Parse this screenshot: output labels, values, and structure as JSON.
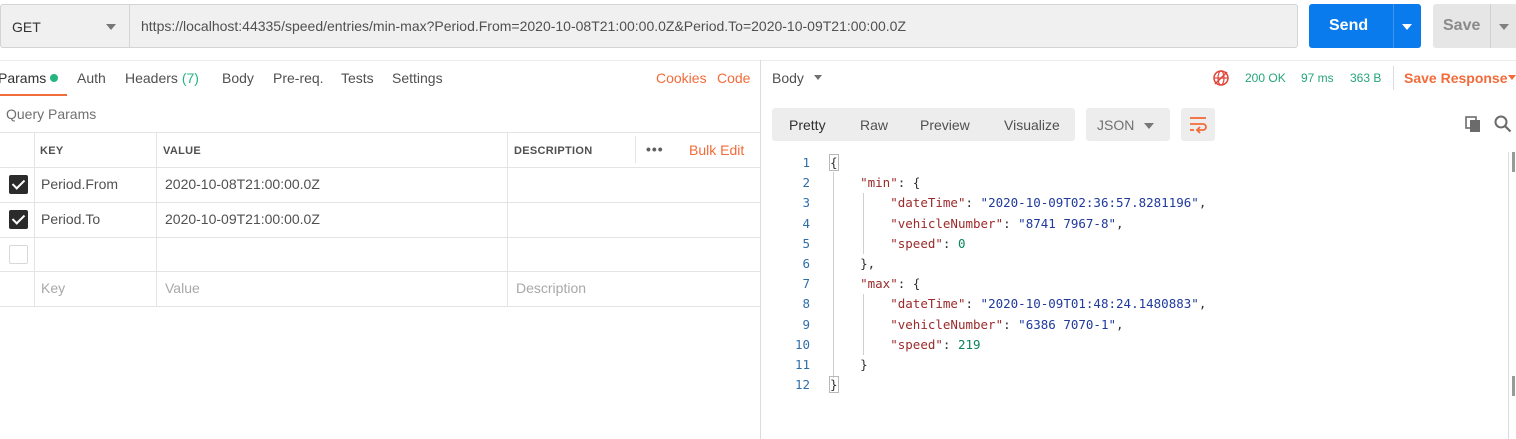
{
  "request": {
    "method": "GET",
    "url": "https://localhost:44335/speed/entries/min-max?Period.From=2020-10-08T21:00:00.0Z&Period.To=2020-10-09T21:00:00.0Z",
    "send_label": "Send",
    "save_label": "Save"
  },
  "request_tabs": {
    "params": "Params",
    "auth": "Auth",
    "headers": "Headers",
    "headers_count": "(7)",
    "body": "Body",
    "prereq": "Pre-req.",
    "tests": "Tests",
    "settings": "Settings",
    "cookies": "Cookies",
    "code": "Code"
  },
  "query_params": {
    "title": "Query Params",
    "columns": {
      "key": "KEY",
      "value": "VALUE",
      "description": "DESCRIPTION"
    },
    "bulk_edit": "Bulk Edit",
    "rows": [
      {
        "checked": true,
        "key": "Period.From",
        "value": "2020-10-08T21:00:00.0Z",
        "description": ""
      },
      {
        "checked": true,
        "key": "Period.To",
        "value": "2020-10-09T21:00:00.0Z",
        "description": ""
      }
    ],
    "placeholders": {
      "key": "Key",
      "value": "Value",
      "description": "Description"
    }
  },
  "response": {
    "body_label": "Body",
    "status": "200 OK",
    "time": "97 ms",
    "size": "363 B",
    "save_response": "Save Response",
    "view_tabs": [
      "Pretty",
      "Raw",
      "Preview",
      "Visualize"
    ],
    "format": "JSON",
    "line_numbers": [
      "1",
      "2",
      "3",
      "4",
      "5",
      "6",
      "7",
      "8",
      "9",
      "10",
      "11",
      "12"
    ],
    "json": {
      "min": {
        "dateTime": "2020-10-09T02:36:57.8281196",
        "vehicleNumber": "8741 7967-8",
        "speed": "0"
      },
      "max": {
        "dateTime": "2020-10-09T01:48:24.1480883",
        "vehicleNumber": "6386 7070-1",
        "speed": "219"
      }
    }
  },
  "colors": {
    "accent_orange": "#f26b3a",
    "send_blue": "#097bed",
    "status_green": "#26a57a"
  },
  "icons": [
    "chevron-down-icon",
    "globe-icon",
    "wrap-lines-icon",
    "copy-icon",
    "search-icon",
    "checkbox-checked-icon",
    "more-icon"
  ]
}
